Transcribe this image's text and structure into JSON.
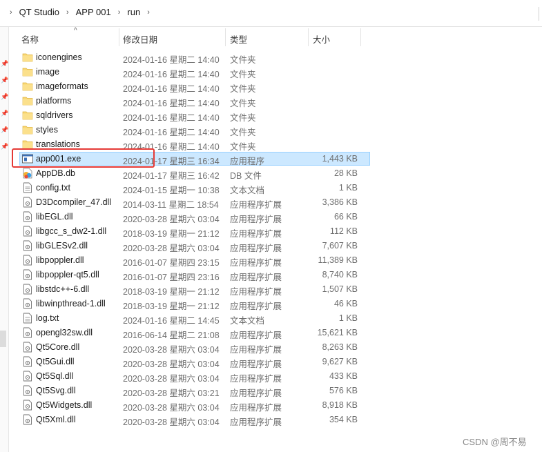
{
  "breadcrumb": [
    "QT Studio",
    "APP 001",
    "run"
  ],
  "columns": {
    "name": "名称",
    "date": "修改日期",
    "type": "类型",
    "size": "大小"
  },
  "files": [
    {
      "name": "iconengines",
      "date": "2024-01-16 星期二 14:40",
      "type": "文件夹",
      "size": "",
      "icon": "folder-icon"
    },
    {
      "name": "image",
      "date": "2024-01-16 星期二 14:40",
      "type": "文件夹",
      "size": "",
      "icon": "folder-icon"
    },
    {
      "name": "imageformats",
      "date": "2024-01-16 星期二 14:40",
      "type": "文件夹",
      "size": "",
      "icon": "folder-icon"
    },
    {
      "name": "platforms",
      "date": "2024-01-16 星期二 14:40",
      "type": "文件夹",
      "size": "",
      "icon": "folder-icon"
    },
    {
      "name": "sqldrivers",
      "date": "2024-01-16 星期二 14:40",
      "type": "文件夹",
      "size": "",
      "icon": "folder-icon"
    },
    {
      "name": "styles",
      "date": "2024-01-16 星期二 14:40",
      "type": "文件夹",
      "size": "",
      "icon": "folder-icon"
    },
    {
      "name": "translations",
      "date": "2024-01-16 星期二 14:40",
      "type": "文件夹",
      "size": "",
      "icon": "folder-icon"
    },
    {
      "name": "app001.exe",
      "date": "2024-01-17 星期三 16:34",
      "type": "应用程序",
      "size": "1,443 KB",
      "icon": "exe-icon",
      "selected": true
    },
    {
      "name": "AppDB.db",
      "date": "2024-01-17 星期三 16:42",
      "type": "DB 文件",
      "size": "28 KB",
      "icon": "db-file-icon"
    },
    {
      "name": "config.txt",
      "date": "2024-01-15 星期一 10:38",
      "type": "文本文档",
      "size": "1 KB",
      "icon": "text-file-icon"
    },
    {
      "name": "D3Dcompiler_47.dll",
      "date": "2014-03-11 星期二 18:54",
      "type": "应用程序扩展",
      "size": "3,386 KB",
      "icon": "dll-file-icon"
    },
    {
      "name": "libEGL.dll",
      "date": "2020-03-28 星期六 03:04",
      "type": "应用程序扩展",
      "size": "66 KB",
      "icon": "dll-file-icon"
    },
    {
      "name": "libgcc_s_dw2-1.dll",
      "date": "2018-03-19 星期一 21:12",
      "type": "应用程序扩展",
      "size": "112 KB",
      "icon": "dll-file-icon"
    },
    {
      "name": "libGLESv2.dll",
      "date": "2020-03-28 星期六 03:04",
      "type": "应用程序扩展",
      "size": "7,607 KB",
      "icon": "dll-file-icon"
    },
    {
      "name": "libpoppler.dll",
      "date": "2016-01-07 星期四 23:15",
      "type": "应用程序扩展",
      "size": "11,389 KB",
      "icon": "dll-file-icon"
    },
    {
      "name": "libpoppler-qt5.dll",
      "date": "2016-01-07 星期四 23:16",
      "type": "应用程序扩展",
      "size": "8,740 KB",
      "icon": "dll-file-icon"
    },
    {
      "name": "libstdc++-6.dll",
      "date": "2018-03-19 星期一 21:12",
      "type": "应用程序扩展",
      "size": "1,507 KB",
      "icon": "dll-file-icon"
    },
    {
      "name": "libwinpthread-1.dll",
      "date": "2018-03-19 星期一 21:12",
      "type": "应用程序扩展",
      "size": "46 KB",
      "icon": "dll-file-icon"
    },
    {
      "name": "log.txt",
      "date": "2024-01-16 星期二 14:45",
      "type": "文本文档",
      "size": "1 KB",
      "icon": "text-file-icon"
    },
    {
      "name": "opengl32sw.dll",
      "date": "2016-06-14 星期二 21:08",
      "type": "应用程序扩展",
      "size": "15,621 KB",
      "icon": "dll-file-icon"
    },
    {
      "name": "Qt5Core.dll",
      "date": "2020-03-28 星期六 03:04",
      "type": "应用程序扩展",
      "size": "8,263 KB",
      "icon": "dll-file-icon"
    },
    {
      "name": "Qt5Gui.dll",
      "date": "2020-03-28 星期六 03:04",
      "type": "应用程序扩展",
      "size": "9,627 KB",
      "icon": "dll-file-icon"
    },
    {
      "name": "Qt5Sql.dll",
      "date": "2020-03-28 星期六 03:04",
      "type": "应用程序扩展",
      "size": "433 KB",
      "icon": "dll-file-icon"
    },
    {
      "name": "Qt5Svg.dll",
      "date": "2020-03-28 星期六 03:21",
      "type": "应用程序扩展",
      "size": "576 KB",
      "icon": "dll-file-icon"
    },
    {
      "name": "Qt5Widgets.dll",
      "date": "2020-03-28 星期六 03:04",
      "type": "应用程序扩展",
      "size": "8,918 KB",
      "icon": "dll-file-icon"
    },
    {
      "name": "Qt5Xml.dll",
      "date": "2020-03-28 星期六 03:04",
      "type": "应用程序扩展",
      "size": "354 KB",
      "icon": "dll-file-icon"
    }
  ],
  "watermark": "CSDN @周不易",
  "colors": {
    "selection": "#cce8ff",
    "annotation": "#e53935",
    "folder": "#f8d775"
  }
}
